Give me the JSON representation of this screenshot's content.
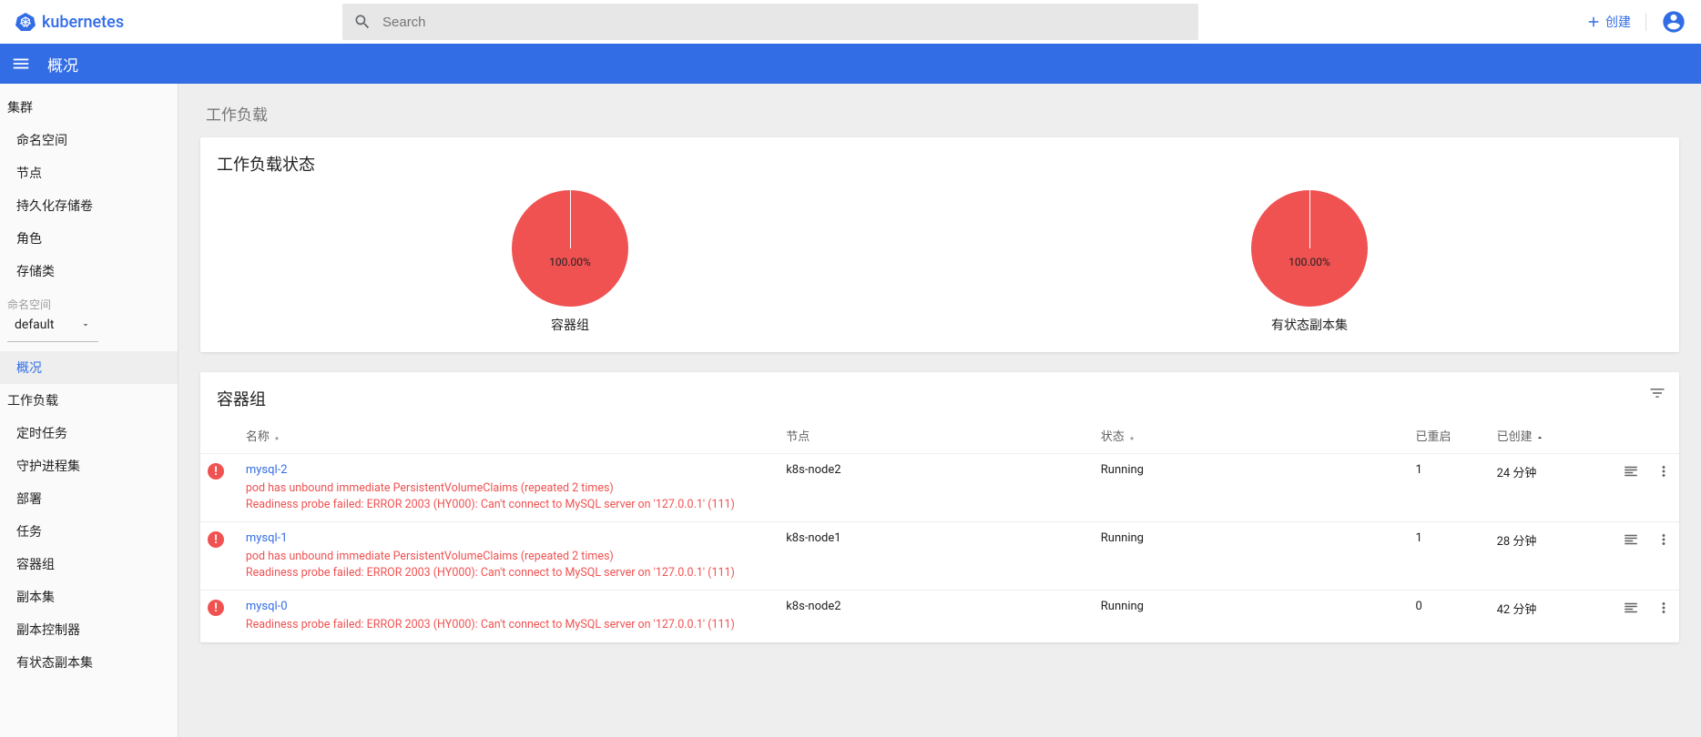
{
  "brand": "kubernetes",
  "search": {
    "placeholder": "Search"
  },
  "create_label": "创建",
  "bluebar_title": "概况",
  "sidebar": {
    "cluster_label": "集群",
    "cluster_items": [
      "命名空间",
      "节点",
      "持久化存储卷",
      "角色",
      "存储类"
    ],
    "ns_label": "命名空间",
    "ns_selected": "default",
    "overview_label": "概况",
    "workload_label": "工作负载",
    "workload_items": [
      "定时任务",
      "守护进程集",
      "部署",
      "任务",
      "容器组",
      "副本集",
      "副本控制器",
      "有状态副本集"
    ]
  },
  "content": {
    "section_workload": "工作负载",
    "workload_status_title": "工作负载状态",
    "pods_title": "容器组",
    "table_headers": {
      "name": "名称",
      "node": "节点",
      "state": "状态",
      "restarts": "已重启",
      "created": "已创建"
    },
    "pods": [
      {
        "name": "mysql-2",
        "node": "k8s-node2",
        "state": "Running",
        "restarts": "1",
        "created": "24 分钟",
        "errors": [
          "pod has unbound immediate PersistentVolumeClaims (repeated 2 times)",
          "Readiness probe failed: ERROR 2003 (HY000): Can't connect to MySQL server on '127.0.0.1' (111)"
        ]
      },
      {
        "name": "mysql-1",
        "node": "k8s-node1",
        "state": "Running",
        "restarts": "1",
        "created": "28 分钟",
        "errors": [
          "pod has unbound immediate PersistentVolumeClaims (repeated 2 times)",
          "Readiness probe failed: ERROR 2003 (HY000): Can't connect to MySQL server on '127.0.0.1' (111)"
        ]
      },
      {
        "name": "mysql-0",
        "node": "k8s-node2",
        "state": "Running",
        "restarts": "0",
        "created": "42 分钟",
        "errors": [
          "Readiness probe failed: ERROR 2003 (HY000): Can't connect to MySQL server on '127.0.0.1' (111)"
        ]
      }
    ]
  },
  "chart_data": [
    {
      "type": "pie",
      "title": "容器组",
      "slices": [
        {
          "label": "100.00%",
          "value": 100,
          "color": "#f05252"
        }
      ]
    },
    {
      "type": "pie",
      "title": "有状态副本集",
      "slices": [
        {
          "label": "100.00%",
          "value": 100,
          "color": "#f05252"
        }
      ]
    }
  ]
}
